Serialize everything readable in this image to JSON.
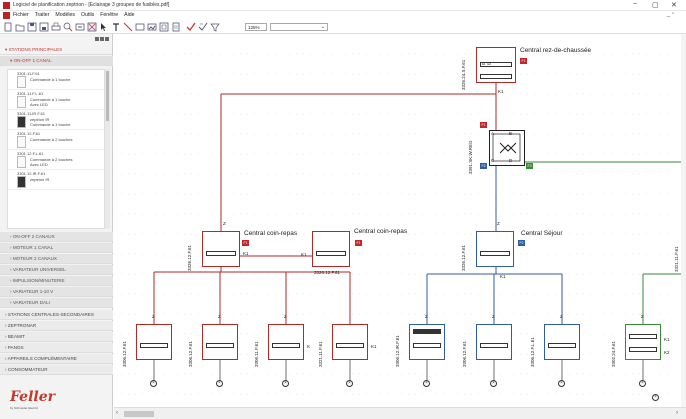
{
  "window": {
    "title": "Logiciel de planification zeptrion - [Eclairage 3 groupes de fusibles.pdf]",
    "controls": [
      "−",
      "▢",
      "✕"
    ]
  },
  "menu": [
    "Fichier",
    "Traiter",
    "Modèles",
    "Outils",
    "Fenêtre",
    "Aide"
  ],
  "toolbar": {
    "zoom": "125%",
    "icons": [
      "new-icon",
      "open-icon",
      "save-icon",
      "save-as-icon",
      "print-icon",
      "preview-icon",
      "export-icon",
      "zoom-box-icon",
      "text-icon",
      "line-icon",
      "rectangle-icon",
      "image-icon",
      "grid-icon",
      "page-icon",
      "check-icon",
      "check-all-icon"
    ]
  },
  "sidebar": {
    "stations_principales": "STATIONS PRINCIPALES",
    "on_off_1_canal": "ON-OFF 1 CANAL",
    "items": [
      {
        "code": "3301.11.F.61",
        "d1": "Commande à 1 touche",
        "d2": ""
      },
      {
        "code": "3301.11.F.L.61",
        "d1": "Commande à 1 touche",
        "d2": "Avec LED"
      },
      {
        "code": "3301.11.IR.F.61",
        "d1": "zeptrion IR",
        "d2": "Commande à 1 touche"
      },
      {
        "code": "3301.12.F.61",
        "d1": "Commande à 2 touches",
        "d2": ""
      },
      {
        "code": "3301.12.F.L.61",
        "d1": "Commande à 2 touches",
        "d2": "Avec LED"
      },
      {
        "code": "3301.12.IR.F.61",
        "d1": "zeptrion IR",
        "d2": ""
      }
    ],
    "sections": [
      "ON-OFF 2 CANAUX",
      "MOTEUR 1 CANAL",
      "MOTEUR 2 CANAUX",
      "VARIATEUR UNIVERSEL",
      "IMPULSION/MINUTERIE",
      "VARIATEUR 1-10 V",
      "VARIATEUR DALI"
    ],
    "groups": [
      "STATIONS CENTRALES-SECONDAIRES",
      "ZEPTRONAR",
      "BEAMIT",
      "PANOS",
      "APPAREILS COMPLÉMENTAIRE",
      "CONSOMMATEUR"
    ],
    "logo": "Feller",
    "logo_sub": "by Schneider Electric"
  },
  "diagram": {
    "central_rdc": {
      "label": "Central rez-de-chaussée",
      "code": "3326.24.S.F.61",
      "k": "K1",
      "tag": "F1",
      "left": "E1",
      "right": "E2"
    },
    "sensor": {
      "code": "3391.SK.W.REG",
      "tag_r": "F1",
      "tag_b": "F2",
      "tag_g": "F3",
      "a": "A",
      "b": "B",
      "c": "C",
      "d": "D"
    },
    "central_coin_repas_1": {
      "label": "Central coin-repas",
      "code": "3326.12.F.61",
      "z": "Z",
      "k": "K1",
      "tag": "F1"
    },
    "central_coin_repas_2": {
      "label": "Central coin-repas",
      "code": "3326.12.F.61",
      "k": "K1",
      "tag": "F1"
    },
    "central_sejour": {
      "label": "Central Séjour",
      "code": "3326.12.F.61",
      "z": "Z",
      "k": "K1",
      "tag": "F2"
    },
    "right_edge_code": "3321.11.F.61",
    "bottom_devices": [
      {
        "code": "3306.12.F.61",
        "z": "Z",
        "k": "",
        "color": "r"
      },
      {
        "code": "3306.12.F.61",
        "z": "Z",
        "k": "",
        "color": "r"
      },
      {
        "code": "3306.11.F.61",
        "z": "Z",
        "k": "K",
        "color": "r"
      },
      {
        "code": "3321.11.F.61",
        "z": "",
        "k": "K1",
        "color": "r"
      },
      {
        "code": "3306.12.IR.F.61",
        "z": "Z",
        "k": "",
        "color": "b"
      },
      {
        "code": "3306.12.F.61",
        "z": "Z",
        "k": "",
        "color": "b"
      },
      {
        "code": "3306.12.F.L.61",
        "z": "Z",
        "k": "",
        "color": "b"
      },
      {
        "code": "3302.24.F.61",
        "z": "Z",
        "k": "K1",
        "k2": "K2",
        "color": "g"
      }
    ],
    "lamp_symbol": "⊗"
  },
  "colors": {
    "red": "#b02a2a",
    "blue": "#2f5e9e",
    "green": "#3a8a3a",
    "grid": "#d8d8d8"
  }
}
